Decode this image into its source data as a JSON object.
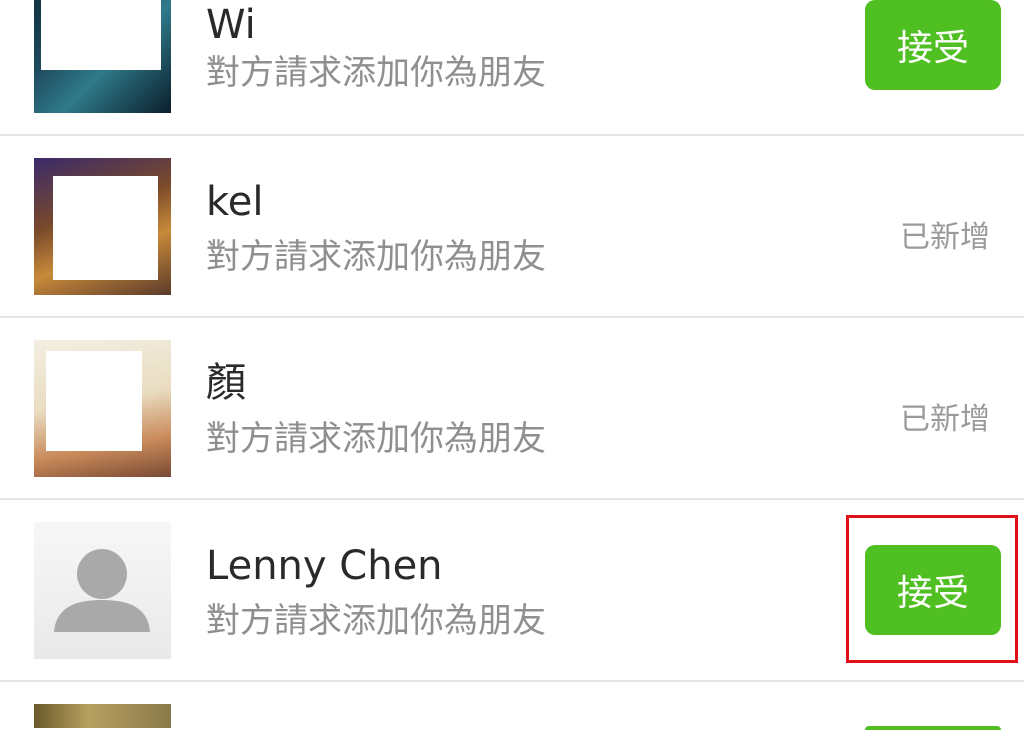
{
  "requests": [
    {
      "name": "Wi",
      "subtitle": "對方請求添加你為朋友",
      "action_label": "接受",
      "state": "pending"
    },
    {
      "name": "kel",
      "subtitle": "對方請求添加你為朋友",
      "action_label": "已新增",
      "state": "added"
    },
    {
      "name": "顏",
      "subtitle": "對方請求添加你為朋友",
      "action_label": "已新增",
      "state": "added"
    },
    {
      "name": "Lenny Chen",
      "subtitle": "對方請求添加你為朋友",
      "action_label": "接受",
      "state": "pending",
      "highlighted": true
    }
  ],
  "colors": {
    "accept_button": "#4fbf22",
    "highlight": "#e0101a",
    "added_text": "#9a9a9a"
  }
}
